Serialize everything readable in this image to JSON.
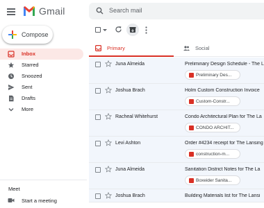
{
  "header": {
    "brand": "Gmail",
    "search_placeholder": "Search mail",
    "accent_color": "#d93025"
  },
  "compose": {
    "label": "Compose"
  },
  "nav": {
    "items": [
      {
        "label": "Inbox",
        "icon": "inbox-icon",
        "active": true
      },
      {
        "label": "Starred",
        "icon": "star-icon"
      },
      {
        "label": "Snoozed",
        "icon": "clock-icon"
      },
      {
        "label": "Sent",
        "icon": "send-icon"
      },
      {
        "label": "Drafts",
        "icon": "draft-icon"
      },
      {
        "label": "More",
        "icon": "chevron-down-icon"
      }
    ]
  },
  "meet": {
    "title": "Meet",
    "start_label": "Start a meeting"
  },
  "tabs": [
    {
      "label": "Primary",
      "icon": "inbox-icon",
      "active": true
    },
    {
      "label": "Social",
      "icon": "people-icon"
    }
  ],
  "emails": [
    {
      "sender": "Juna Almeida",
      "subject": "Preliminary Design Schedule - The L",
      "attachment": "Preliminary Des..."
    },
    {
      "sender": "Joshua Brach",
      "subject": "Holm Custom Construction Invoice",
      "attachment": "Custom-Constr..."
    },
    {
      "sender": "Racheal Whitehurst",
      "subject": "Condo Architectural Plan for The La",
      "attachment": "CONDO ARCHIT..."
    },
    {
      "sender": "Levi Ashton",
      "subject": "Order #4234 receipt for The Lansing",
      "attachment": "construction-m..."
    },
    {
      "sender": "Juna Almeida",
      "subject": "Sanitation District Notes for The La",
      "attachment": "Boxeider Sanita..."
    },
    {
      "sender": "Joshua Brach",
      "subject": "Building Materials list for The Lansi",
      "attachment": ""
    }
  ]
}
